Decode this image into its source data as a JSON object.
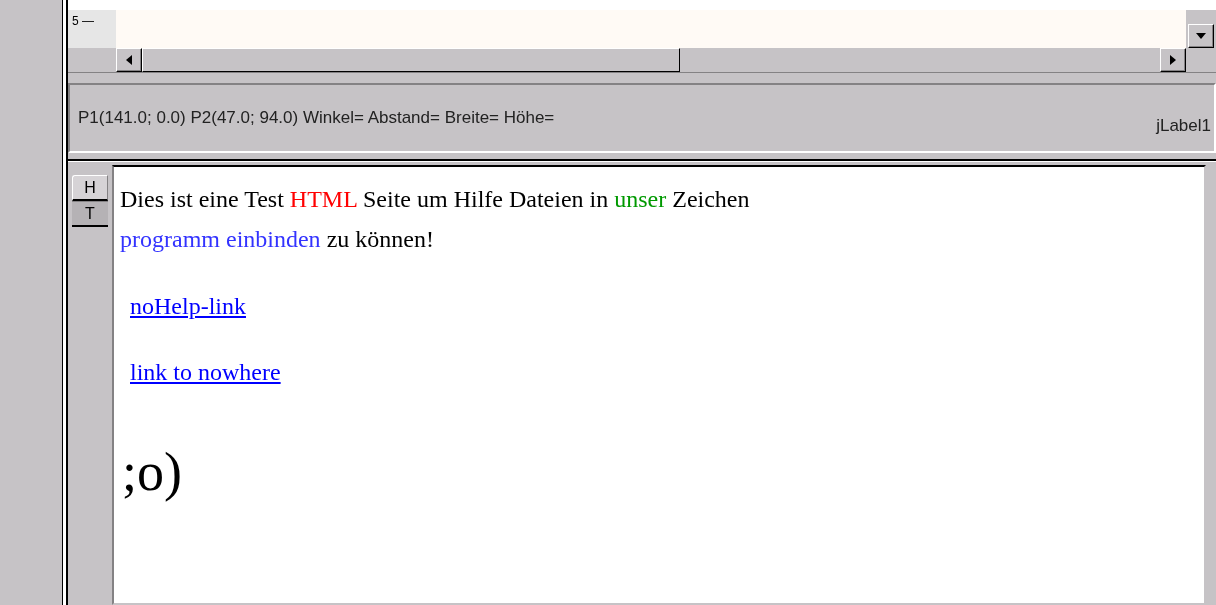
{
  "ruler": {
    "label": "5 —"
  },
  "status_bar": {
    "coordinates": "P1(141.0; 0.0) P2(47.0; 94.0) Winkel= Abstand= Breite= Höhe=",
    "label": "jLabel1"
  },
  "side_tabs": [
    {
      "label": "H",
      "selected": true
    },
    {
      "label": "T",
      "selected": false
    }
  ],
  "help_page": {
    "paragraph": [
      {
        "text": "Dies ist eine Test ",
        "color": "#000000"
      },
      {
        "text": "HTML",
        "color": "#ff0000"
      },
      {
        "text": " Seite um Hilfe Dateien in ",
        "color": "#000000"
      },
      {
        "text": "unser",
        "color": "#009900"
      },
      {
        "text": " Zeichen ",
        "color": "#000000"
      },
      {
        "text": "programm einbinden",
        "color": "#3333ff"
      },
      {
        "text": " zu können!",
        "color": "#000000"
      }
    ],
    "links": [
      "noHelp-link",
      "link to nowhere"
    ],
    "smiley": ";o)"
  }
}
